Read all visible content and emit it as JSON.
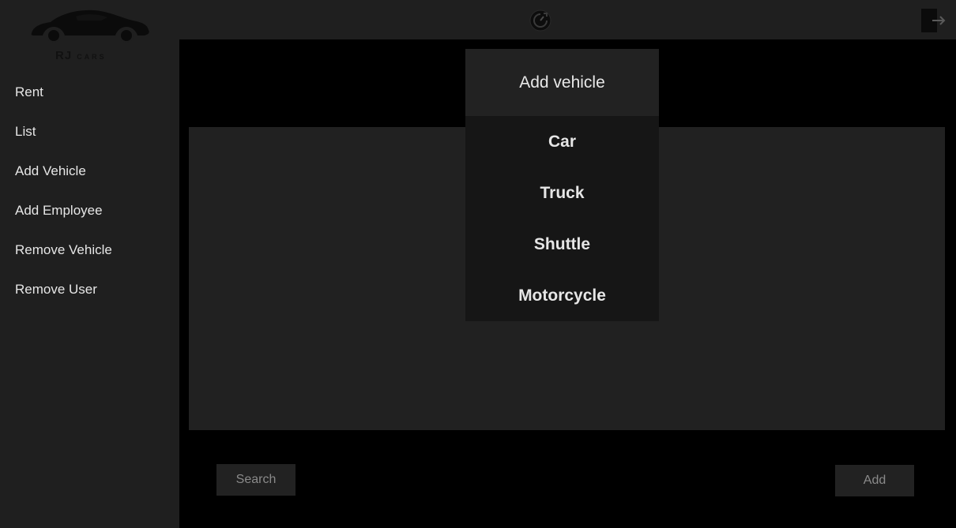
{
  "brand": {
    "name": "RJ",
    "sub": "CARS"
  },
  "sidebar": {
    "items": [
      {
        "label": "Rent"
      },
      {
        "label": "List"
      },
      {
        "label": "Add Vehicle"
      },
      {
        "label": "Add Employee"
      },
      {
        "label": "Remove Vehicle"
      },
      {
        "label": "Remove User"
      }
    ]
  },
  "dropdown": {
    "title": "Add vehicle",
    "items": [
      {
        "label": "Car"
      },
      {
        "label": "Truck"
      },
      {
        "label": "Shuttle"
      },
      {
        "label": "Motorcycle"
      }
    ]
  },
  "actions": {
    "search_label": "Search",
    "add_label": "Add"
  },
  "icons": {
    "logo": "car-silhouette-icon",
    "timer": "timer-icon",
    "logout": "logout-icon"
  },
  "colors": {
    "sidebar_bg": "#1f1f1f",
    "main_bg": "#000000",
    "panel_bg": "#212121",
    "text": "#e6e6e6"
  }
}
